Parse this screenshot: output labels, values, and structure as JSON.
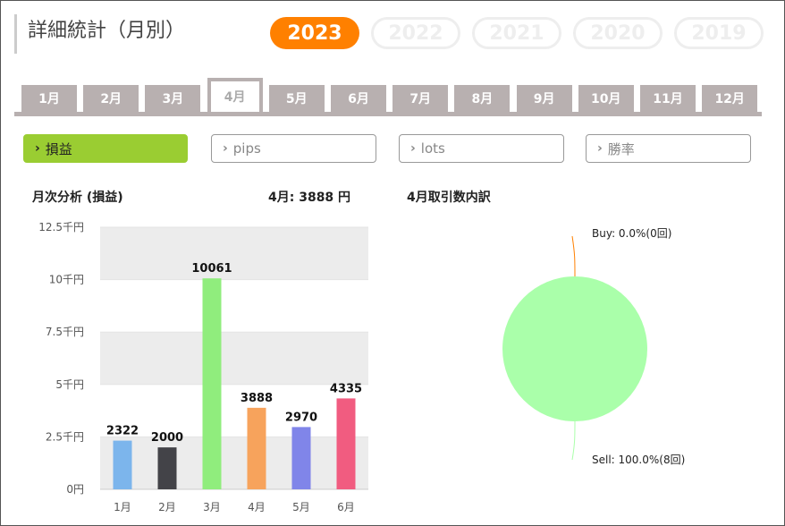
{
  "title": "詳細統計（月別）",
  "years": [
    {
      "label": "2023",
      "active": true
    },
    {
      "label": "2022",
      "active": false
    },
    {
      "label": "2021",
      "active": false
    },
    {
      "label": "2020",
      "active": false
    },
    {
      "label": "2019",
      "active": false
    }
  ],
  "months": [
    {
      "label": "1月",
      "active": false
    },
    {
      "label": "2月",
      "active": false
    },
    {
      "label": "3月",
      "active": false
    },
    {
      "label": "4月",
      "active": true
    },
    {
      "label": "5月",
      "active": false
    },
    {
      "label": "6月",
      "active": false
    },
    {
      "label": "7月",
      "active": false
    },
    {
      "label": "8月",
      "active": false
    },
    {
      "label": "9月",
      "active": false
    },
    {
      "label": "10月",
      "active": false
    },
    {
      "label": "11月",
      "active": false
    },
    {
      "label": "12月",
      "active": false
    }
  ],
  "filters": [
    {
      "label": "損益",
      "active": true
    },
    {
      "label": "pips",
      "active": false
    },
    {
      "label": "lots",
      "active": false
    },
    {
      "label": "勝率",
      "active": false
    }
  ],
  "bar_section": {
    "title": "月次分析 (損益)",
    "summary": "4月:  3888 円"
  },
  "pie_section": {
    "title": "4月取引数内訳"
  },
  "chart_data": [
    {
      "type": "bar",
      "categories": [
        "1月",
        "2月",
        "3月",
        "4月",
        "5月",
        "6月"
      ],
      "values": [
        2322,
        2000,
        10061,
        3888,
        2970,
        4335
      ],
      "data_labels": [
        "2322",
        "2000",
        "10061",
        "3888",
        "2970",
        "4335"
      ],
      "colors": [
        "#7cb5ec",
        "#434348",
        "#90ed7d",
        "#f7a35c",
        "#8085e9",
        "#f15c80"
      ],
      "ylim": [
        0,
        12500
      ],
      "yticks": [
        {
          "value": 0,
          "label": "0円"
        },
        {
          "value": 2500,
          "label": "2.5千円"
        },
        {
          "value": 5000,
          "label": "5千円"
        },
        {
          "value": 7500,
          "label": "7.5千円"
        },
        {
          "value": 10000,
          "label": "10千円"
        },
        {
          "value": 12500,
          "label": "12.5千円"
        }
      ],
      "alternating_bands": true
    },
    {
      "type": "pie",
      "slices": [
        {
          "name": "Buy",
          "value": 0,
          "label": "Buy: 0.0%(0回)",
          "color": "#ff8000"
        },
        {
          "name": "Sell",
          "value": 8,
          "label": "Sell: 100.0%(8回)",
          "color": "#aaffaa"
        }
      ]
    }
  ]
}
